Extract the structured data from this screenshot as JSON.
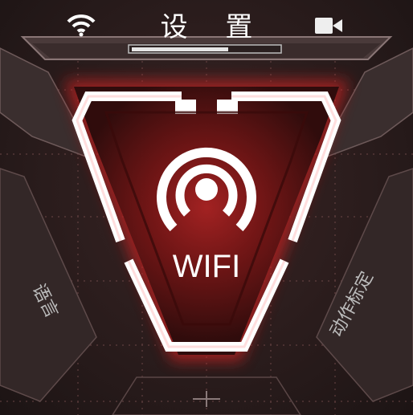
{
  "header": {
    "title": "设 置",
    "wifi_icon": "wifi-icon",
    "video_icon": "video-camera-icon"
  },
  "main": {
    "selected_item": "WIFI",
    "center_icon": "wireless-broadcast-icon"
  },
  "side_items": {
    "left": "语言",
    "right": "动作标定"
  },
  "colors": {
    "accent": "#d43a3a",
    "frame": "#ffffff",
    "background": "#2a1c1c"
  }
}
